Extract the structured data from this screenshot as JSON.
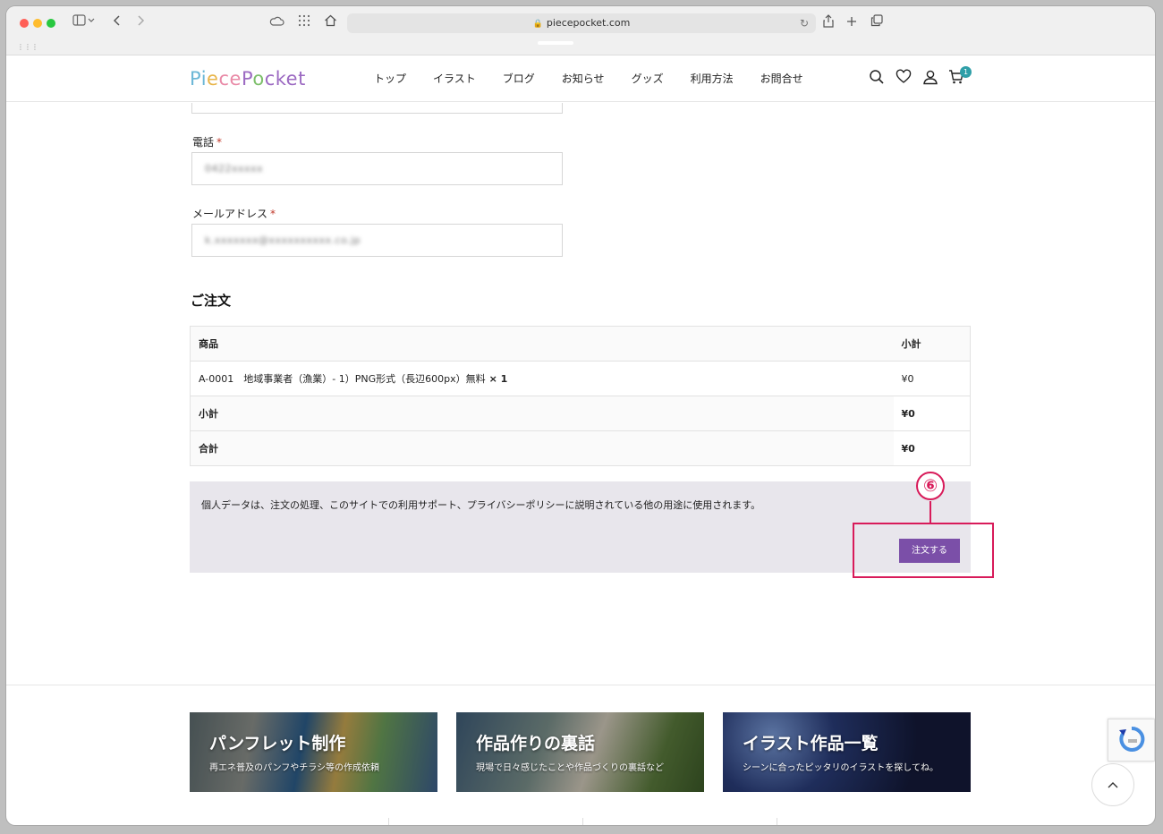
{
  "browser": {
    "url": "piecepocket.com"
  },
  "site": {
    "logo": {
      "part1": "Pi",
      "part2": "e",
      "part3": "ce",
      "part4": "P",
      "part5": "o",
      "part6": "cket"
    },
    "nav": [
      "トップ",
      "イラスト",
      "ブログ",
      "お知らせ",
      "グッズ",
      "利用方法",
      "お問合せ"
    ],
    "cart_count": "1"
  },
  "form": {
    "phone_label": "電話",
    "phone_value": "0422xxxxx",
    "email_label": "メールアドレス",
    "email_value": "k.xxxxxxx@xxxxxxxxxx.co.jp",
    "required_mark": "*"
  },
  "order": {
    "title": "ご注文",
    "headers": {
      "product": "商品",
      "subtotal": "小計"
    },
    "item": {
      "name": "A-0001　地域事業者（漁業）- 1）PNG形式（長辺600px）無料",
      "qty": "× 1",
      "price": "¥0"
    },
    "subtotal_label": "小計",
    "subtotal_value": "¥0",
    "total_label": "合計",
    "total_value": "¥0",
    "privacy_text": "個人データは、注文の処理、このサイトでの利用サポート、プライバシーポリシーに説明されている他の用途に使用されます。",
    "place_order_label": "注文する",
    "callout_number": "⑥"
  },
  "footer": {
    "banners": [
      {
        "title": "パンフレット制作",
        "subtitle": "再エネ普及のパンフやチラシ等の作成依頼"
      },
      {
        "title": "作品作りの裏話",
        "subtitle": "現場で日々感じたことや作品づくりの裏話など"
      },
      {
        "title": "イラスト作品一覧",
        "subtitle": "シーンに合ったピッタリのイラストを探してね。"
      }
    ]
  },
  "colors": {
    "accent": "#7b4fa8",
    "highlight": "#d81b5a",
    "badge": "#2f9fa8"
  }
}
